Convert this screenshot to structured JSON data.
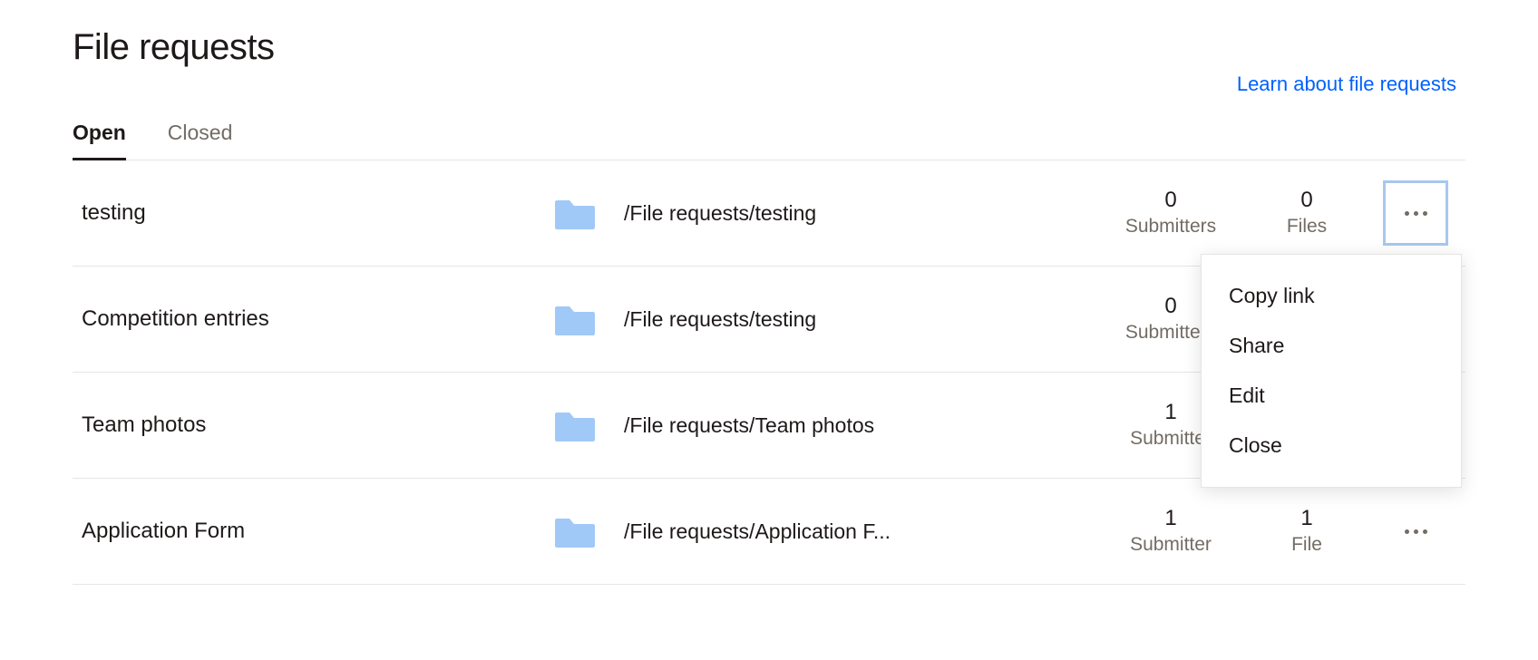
{
  "title": "File requests",
  "learn_link": "Learn about file requests",
  "tabs": {
    "open": "Open",
    "closed": "Closed"
  },
  "rows": [
    {
      "name": "testing",
      "path": "/File requests/testing",
      "submitters_n": "0",
      "submitters_l": "Submitters",
      "files_n": "0",
      "files_l": "Files"
    },
    {
      "name": "Competition entries",
      "path": "/File requests/testing",
      "submitters_n": "0",
      "submitters_l": "Submitters",
      "files_n": "",
      "files_l": ""
    },
    {
      "name": "Team photos",
      "path": "/File requests/Team photos",
      "submitters_n": "1",
      "submitters_l": "Submitter",
      "files_n": "",
      "files_l": ""
    },
    {
      "name": "Application Form",
      "path": "/File requests/Application F...",
      "submitters_n": "1",
      "submitters_l": "Submitter",
      "files_n": "1",
      "files_l": "File"
    }
  ],
  "menu": {
    "copy": "Copy link",
    "share": "Share",
    "edit": "Edit",
    "close": "Close"
  }
}
